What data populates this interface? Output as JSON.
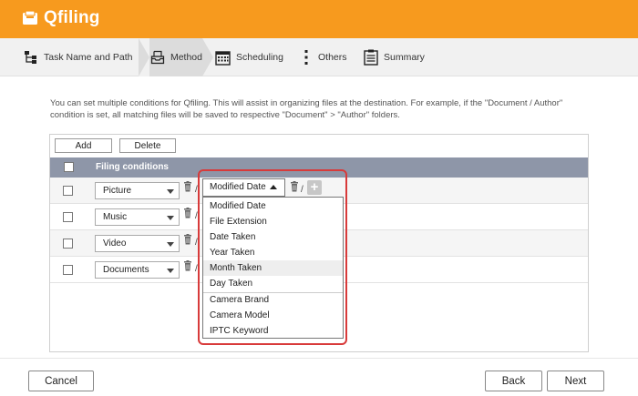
{
  "app": {
    "logo_text": "Qfiling",
    "accent": "#f79a1e"
  },
  "steps": [
    {
      "label": "Task Name and Path",
      "icon": "sitemap-icon"
    },
    {
      "label": "Method",
      "icon": "inbox-icon",
      "active": true
    },
    {
      "label": "Scheduling",
      "icon": "calendar-icon"
    },
    {
      "label": "Others",
      "icon": "more-vertical-icon"
    },
    {
      "label": "Summary",
      "icon": "clipboard-icon"
    }
  ],
  "description": "You can set multiple conditions for Qfiling. This will assist in organizing files at the destination. For example, if the \"Document / Author\" condition is set, all matching files will be saved to respective \"Document\" > \"Author\" folders.",
  "toolbar": {
    "add_label": "Add",
    "delete_label": "Delete"
  },
  "table": {
    "header": "Filing conditions",
    "rows": [
      {
        "category": "Picture",
        "condition": "Modified Date"
      },
      {
        "category": "Music"
      },
      {
        "category": "Video"
      },
      {
        "category": "Documents"
      }
    ],
    "separator": "/"
  },
  "dropdown": {
    "options": [
      "Modified Date",
      "File Extension",
      "Date Taken",
      "Year Taken",
      "Month Taken",
      "Day Taken",
      "Camera Brand",
      "Camera Model",
      "IPTC Keyword"
    ],
    "highlighted": "Month Taken"
  },
  "plus_label": "+",
  "footer": {
    "cancel_label": "Cancel",
    "back_label": "Back",
    "next_label": "Next"
  }
}
